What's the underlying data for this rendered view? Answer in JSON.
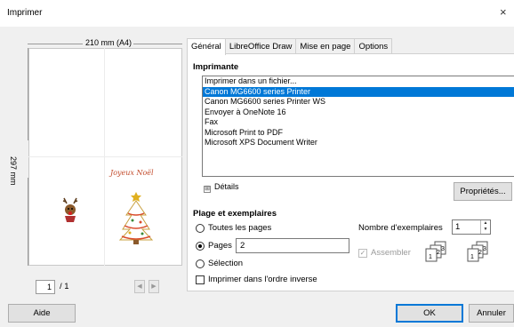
{
  "window": {
    "title": "Imprimer",
    "close_glyph": "×"
  },
  "preview": {
    "paper_size": "210 mm (A4)",
    "paper_height": "297 mm",
    "card_text": "Joyeux Noël",
    "current_page": "1",
    "total_pages": "/ 1",
    "nav_prev": "◀",
    "nav_next": "▶"
  },
  "tabs": [
    "Général",
    "LibreOffice Draw",
    "Mise en page",
    "Options"
  ],
  "printer": {
    "heading": "Imprimante",
    "items": [
      "Imprimer dans un fichier...",
      "Canon MG6600 series Printer",
      "Canon MG6600 series Printer WS",
      "Envoyer à OneNote 16",
      "Fax",
      "Microsoft Print to PDF",
      "Microsoft XPS Document Writer"
    ],
    "selected_index": 1,
    "details_label": "Détails",
    "properties_label": "Propriétés..."
  },
  "range": {
    "heading": "Plage et exemplaires",
    "all_pages": "Toutes les pages",
    "pages": "Pages",
    "pages_value": "2",
    "selection": "Sélection",
    "reverse_order": "Imprimer dans l'ordre inverse",
    "copies_label": "Nombre d'exemplaires",
    "copies_value": "1",
    "collate_label": "Assembler",
    "selected_option": "pages"
  },
  "buttons": {
    "help": "Aide",
    "ok": "OK",
    "cancel": "Annuler"
  },
  "colors": {
    "selection": "#0078d7",
    "accent": "#0078d7"
  },
  "icons": {
    "expander": "⊞",
    "spinner": "up-down-arrows-icon",
    "collate": "collate-pages-icon"
  }
}
